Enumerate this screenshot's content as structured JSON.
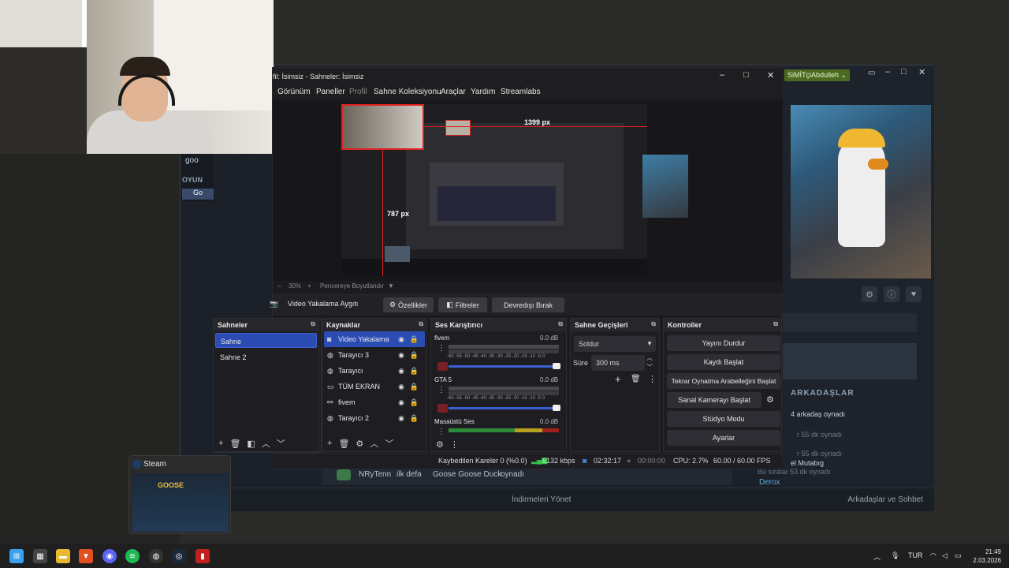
{
  "steam": {
    "user": "SiMİTçiAbdulleh ⌄",
    "search_text": "goo",
    "section_games": "OYUN",
    "game_item": "Go",
    "friends_heading": "ARKADAŞLAR",
    "friend_line1": "4 arkadaş oynadı",
    "friend_time1": "r 55 dk oynadı",
    "friend_time2": "r 55 dk oynadı",
    "friend_name2": "el Mutabıg",
    "friend_time3": "Bu sıralar 53 dk oynadı",
    "friend_derox": "Derox",
    "activity_user": "NRyTenn",
    "activity_text": "ilk defa",
    "activity_game": "Goose Goose Duck",
    "activity_suffix": "oynadı",
    "downloads": "İndirmeleri Yönet",
    "friends_chat": "Arkadaşlar ve Sohbet"
  },
  "obs": {
    "title": "fil: İsimsiz - Sahneler: İsimsiz",
    "menu": [
      "Görünüm",
      "Paneller",
      "Profil",
      "Sahne Koleksiyonu",
      "Araçlar",
      "Yardım",
      "Streamlabs"
    ],
    "measure_w": "1399 px",
    "measure_h": "787 px",
    "zoom": "30%",
    "fit": "Pencereye Boyutlandır",
    "source_label": "Video Yakalama Aygıtı",
    "btn_props": "Özellikler",
    "btn_filters": "Filtreler",
    "btn_deactivate": "Devredışı Bırak",
    "docks": {
      "scenes": "Sahneler",
      "sources": "Kaynaklar",
      "mixer": "Ses Karıştırıcı",
      "transitions": "Sahne Geçişleri",
      "controls": "Kontroller"
    },
    "scenes": [
      "Sahne",
      "Sahne 2"
    ],
    "sources": [
      "Video Yakalama",
      "Tarayıcı 3",
      "Tarayıcı",
      "TÜM EKRAN",
      "fivem",
      "Tarayıcı 2"
    ],
    "mixer": [
      {
        "name": "fivem",
        "db": "0.0 dB"
      },
      {
        "name": "GTA 5",
        "db": "0.0 dB"
      },
      {
        "name": "Masaüstü Ses",
        "db": "0.0 dB"
      }
    ],
    "scale": "-60 -55 -50 -45 -40 -35 -30 -25 -20 -15 -10 -5 0",
    "transition": "Soldur",
    "duration_label": "Süre",
    "duration": "300 ms",
    "controls": [
      "Yayını Durdur",
      "Kaydı Başlat",
      "Tekrar Oynatma Arabelleğini Başlat",
      "Sanal Kamerayı Başlat",
      "Stüdyo Modu",
      "Ayarlar"
    ],
    "status": {
      "dropped": "Kaybedilen Kareler 0 (%0.0)",
      "kbps": "6132 kbps",
      "live": "02:32:17",
      "rec": "00:00:00",
      "cpu": "CPU: 2.7%",
      "fps": "60.00 / 60.00 FPS"
    }
  },
  "taskbar": {
    "preview_title": "Steam",
    "lang": "TUR",
    "time": "21:49",
    "date": "2.03.2026"
  },
  "colors": {
    "accent": "#2b4db3",
    "red": "#e02020",
    "steam_user": "#4c6b22"
  }
}
